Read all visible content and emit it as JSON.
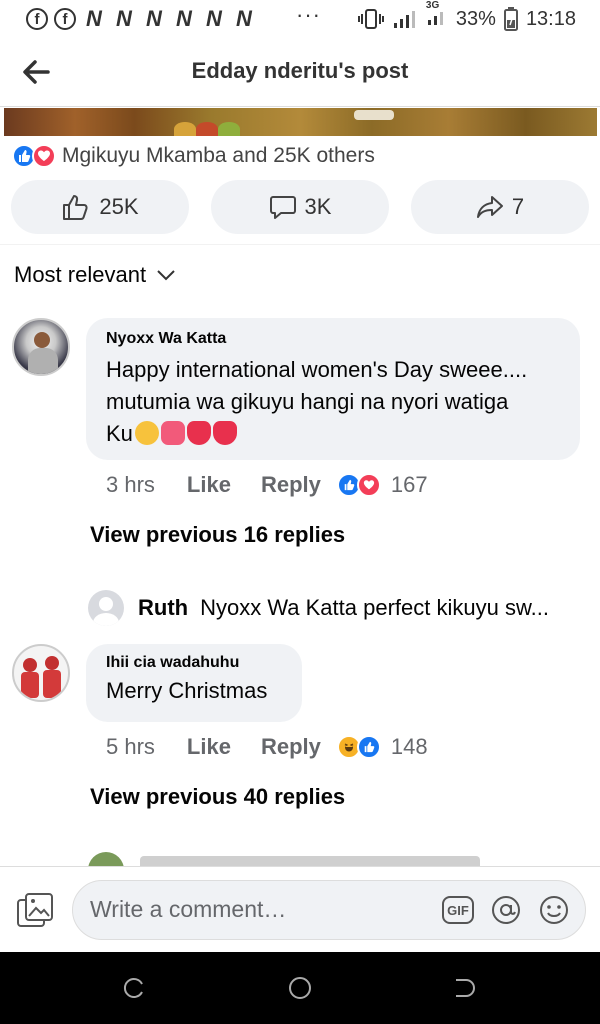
{
  "status_bar": {
    "battery": "33%",
    "time": "13:18",
    "network": "3G",
    "dots": "···"
  },
  "header": {
    "title": "Edday nderitu's post"
  },
  "reactions_summary": {
    "text": "Mgikuyu Mkamba and 25K others"
  },
  "actions": {
    "like_count": "25K",
    "comment_count": "3K",
    "share_count": "7"
  },
  "sort": {
    "label": "Most relevant"
  },
  "comments": [
    {
      "name": "Nyoxx Wa Katta",
      "text_line1": "Happy international women's Day sweee....",
      "text_line2": "mutumia wa gikuyu hangi na nyori watiga",
      "text_line3": "Ku",
      "time": "3 hrs",
      "like": "Like",
      "reply": "Reply",
      "reaction_count": "167",
      "view_previous": "View previous 16 replies"
    },
    {
      "name": "Ihii cia wadahuhu",
      "text": "Merry Christmas",
      "time": "5 hrs",
      "like": "Like",
      "reply": "Reply",
      "reaction_count": "148",
      "view_previous": "View previous 40 replies"
    }
  ],
  "reply_preview": {
    "name": "Ruth",
    "text": "Nyoxx Wa Katta perfect kikuyu sw..."
  },
  "composer": {
    "placeholder": "Write a comment…",
    "gif_label": "GIF"
  },
  "colors": {
    "facebook_blue": "#1877f2",
    "love_red": "#f33e58",
    "haha_yellow": "#f7b125",
    "bubble_bg": "#f0f2f5"
  }
}
